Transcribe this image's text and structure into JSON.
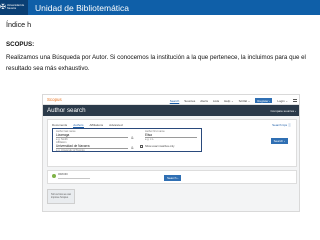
{
  "slide": {
    "header_title": "Unidad de Bibliotemática",
    "logo_text": "Universidad de Navarra",
    "logo_mark": "✠",
    "section_title": "Índice h",
    "subheading": "SCOPUS:",
    "paragraph": "Realizamos una Búsqueda por Autor. Si conocemos la institución a la que pertenece, la incluimos para que el resultado sea más exhaustivo."
  },
  "scopus": {
    "logo": "Scopus",
    "nav_links": [
      "Search",
      "Sources",
      "Alerts",
      "Lists",
      "Help ⌄",
      "SciVal ⌄"
    ],
    "register_label": "Register ›",
    "login_label": "Login ⌄",
    "page_title": "Author search",
    "compare_label": "Compare sources ›",
    "tabs": [
      "Documents",
      "Authors",
      "Affiliations",
      "Advanced"
    ],
    "search_tips": "Search tips ⓘ",
    "form": {
      "lastname_label": "Author last name",
      "lastname_value": "Lizarraga",
      "lastname_example": "e.g. Smith",
      "firstname_label": "Author first name",
      "firstname_value": "Elisa",
      "firstname_example": "e.g. J.L.",
      "affiliation_label": "Affiliation",
      "affiliation_value": "Universidad de Navarra",
      "affiliation_example": "e.g. University of Toronto",
      "and_symbol": "&",
      "or_symbol": "&",
      "exact_match_label": "Show exact matches only",
      "search_button": "Search ›"
    },
    "results_label": "ORCID",
    "results_button": "Search ›",
    "feedback_text": "Tell us how we can improve Scopus"
  },
  "colors": {
    "header_band": "#0f5fa8",
    "scopus_header": "#2b3a4a",
    "scopus_button": "#2f6fb3",
    "scopus_logo": "#e9711c"
  }
}
